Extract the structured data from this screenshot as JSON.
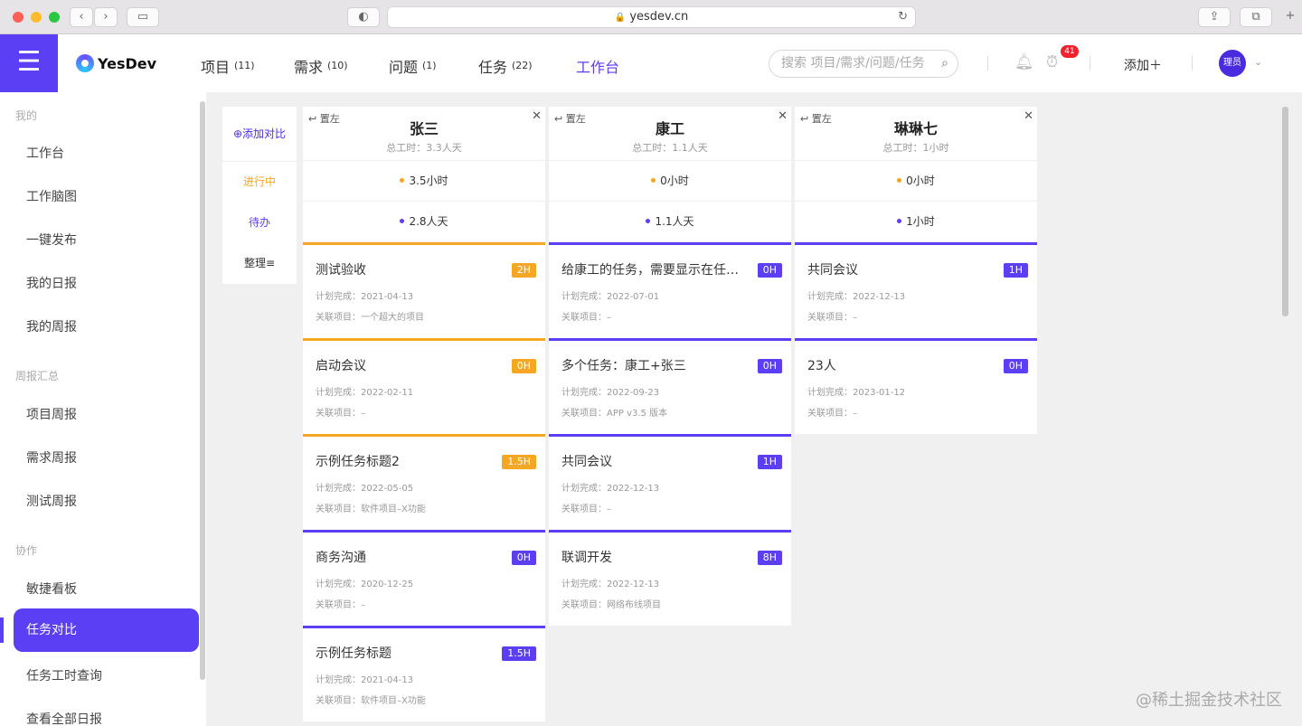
{
  "browser": {
    "url": "yesdev.cn",
    "back": "‹",
    "forward": "›"
  },
  "header": {
    "logo_text": "YesDev",
    "nav": [
      {
        "label": "项目",
        "count": "(11)"
      },
      {
        "label": "需求",
        "count": "(10)"
      },
      {
        "label": "问题",
        "count": "(1)"
      },
      {
        "label": "任务",
        "count": "(22)"
      },
      {
        "label": "工作台",
        "count": ""
      }
    ],
    "search_placeholder": "搜索 项目/需求/问题/任务",
    "notification_count": "41",
    "add_label": "添加＋",
    "avatar_label": "理员",
    "accent": "#5b3ff5"
  },
  "sidebar": {
    "groups": [
      "我的",
      "周报汇总",
      "协作"
    ],
    "items": [
      "工作台",
      "工作脑图",
      "一键发布",
      "我的日报",
      "我的周报",
      "项目周报",
      "需求周报",
      "测试周报",
      "敏捷看板",
      "任务对比",
      "任务工时查询",
      "查看全部日报"
    ],
    "active": "任务对比"
  },
  "compare": {
    "add_label": "添加对比",
    "row_labels": [
      "进行中",
      "待办",
      "整理"
    ],
    "pin_label": "置左",
    "meta_plan": "计划完成：",
    "meta_project": "关联项目：",
    "columns": [
      {
        "name": "张三",
        "total": "总工时：3.3人天",
        "in_progress": "3.5小时",
        "todo": "2.8人天",
        "cards": [
          {
            "title": "测试验收",
            "hours": "2H",
            "date": "2021-04-13",
            "project": "一个超大的项目",
            "color": "orange"
          },
          {
            "title": "启动会议",
            "hours": "0H",
            "date": "2022-02-11",
            "project": "–",
            "color": "orange"
          },
          {
            "title": "示例任务标题2",
            "hours": "1.5H",
            "date": "2022-05-05",
            "project": "软件项目–X功能",
            "color": "orange"
          },
          {
            "title": "商务沟通",
            "hours": "0H",
            "date": "2020-12-25",
            "project": "–",
            "color": "purple"
          },
          {
            "title": "示例任务标题",
            "hours": "1.5H",
            "date": "2021-04-13",
            "project": "软件项目–X功能",
            "color": "purple"
          }
        ]
      },
      {
        "name": "康工",
        "total": "总工时：1.1人天",
        "in_progress": "0小时",
        "todo": "1.1人天",
        "cards": [
          {
            "title": "给康工的任务，需要显示在任务…",
            "hours": "0H",
            "date": "2022-07-01",
            "project": "–",
            "color": "purple"
          },
          {
            "title": "多个任务：康工+张三",
            "hours": "0H",
            "date": "2022-09-23",
            "project": "APP v3.5 版本",
            "color": "purple"
          },
          {
            "title": "共同会议",
            "hours": "1H",
            "date": "2022-12-13",
            "project": "–",
            "color": "purple"
          },
          {
            "title": "联调开发",
            "hours": "8H",
            "date": "2022-12-13",
            "project": "网络布线项目",
            "color": "purple"
          }
        ]
      },
      {
        "name": "琳琳七",
        "total": "总工时：1小时",
        "in_progress": "0小时",
        "todo": "1小时",
        "cards": [
          {
            "title": "共同会议",
            "hours": "1H",
            "date": "2022-12-13",
            "project": "–",
            "color": "purple"
          },
          {
            "title": "23人",
            "hours": "0H",
            "date": "2023-01-12",
            "project": "–",
            "color": "purple"
          }
        ]
      }
    ]
  },
  "corner_watermark": "@稀土掘金技术社区"
}
